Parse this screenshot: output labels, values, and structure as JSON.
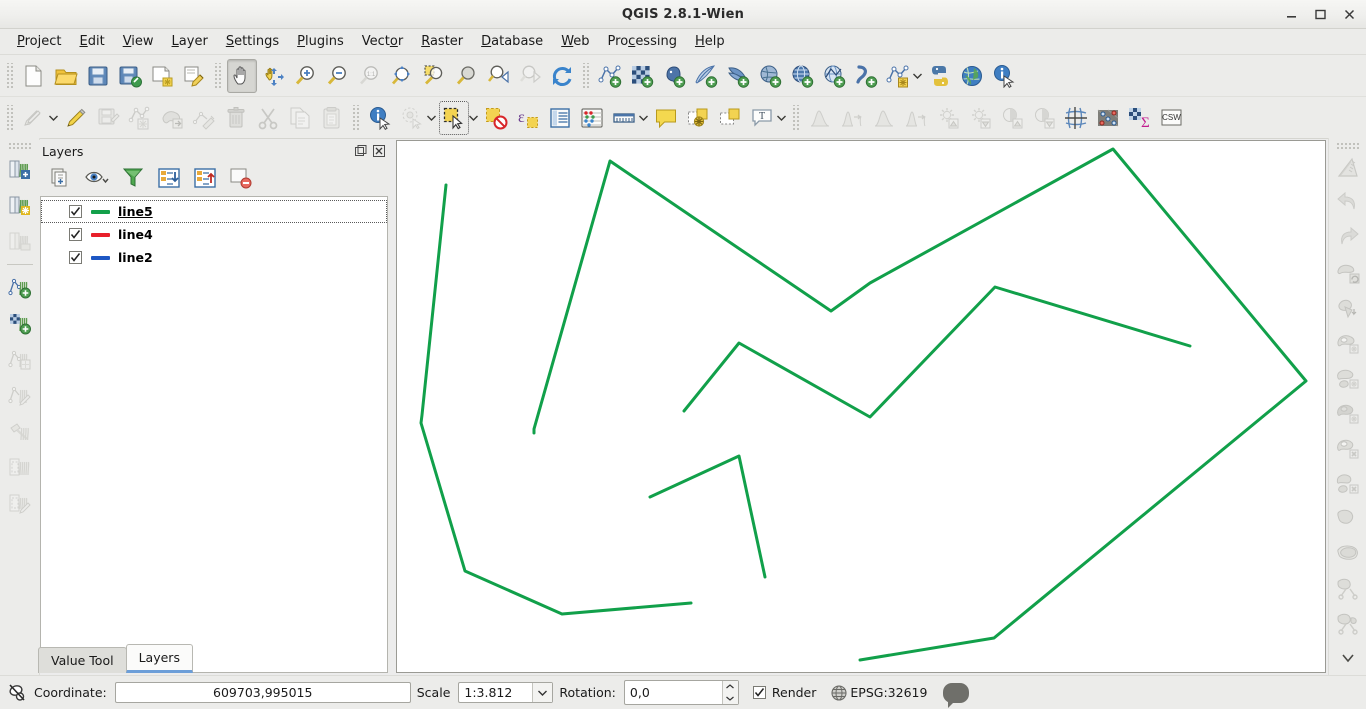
{
  "window": {
    "title": "QGIS 2.8.1-Wien",
    "minimize_label": "Minimize",
    "maximize_label": "Maximize",
    "close_label": "Close"
  },
  "menubar": {
    "items": [
      {
        "label": "Project",
        "mnemonic": "P"
      },
      {
        "label": "Edit",
        "mnemonic": "E"
      },
      {
        "label": "View",
        "mnemonic": "V"
      },
      {
        "label": "Layer",
        "mnemonic": "L"
      },
      {
        "label": "Settings",
        "mnemonic": "S"
      },
      {
        "label": "Plugins",
        "mnemonic": "P"
      },
      {
        "label": "Vector",
        "mnemonic": "o"
      },
      {
        "label": "Raster",
        "mnemonic": "R"
      },
      {
        "label": "Database",
        "mnemonic": "D"
      },
      {
        "label": "Web",
        "mnemonic": "W"
      },
      {
        "label": "Processing",
        "mnemonic": "c"
      },
      {
        "label": "Help",
        "mnemonic": "H"
      }
    ]
  },
  "toolbar_row1": {
    "buttons": [
      {
        "icon": "new-project-icon",
        "label": "New Project",
        "state": "enabled"
      },
      {
        "icon": "open-project-icon",
        "label": "Open Project",
        "state": "enabled"
      },
      {
        "icon": "save-project-icon",
        "label": "Save Project",
        "state": "enabled"
      },
      {
        "icon": "save-project-as-icon",
        "label": "Save Project As",
        "state": "enabled"
      },
      {
        "icon": "new-print-composer-icon",
        "label": "New Print Composer",
        "state": "enabled"
      },
      {
        "icon": "composer-manager-icon",
        "label": "Composer Manager",
        "state": "enabled"
      },
      {
        "icon": "pan-map-icon",
        "label": "Pan Map",
        "state": "active"
      },
      {
        "icon": "pan-to-selection-icon",
        "label": "Pan Map to Selection",
        "state": "enabled"
      },
      {
        "icon": "zoom-in-icon",
        "label": "Zoom In",
        "state": "enabled"
      },
      {
        "icon": "zoom-out-icon",
        "label": "Zoom Out",
        "state": "enabled"
      },
      {
        "icon": "zoom-native-icon",
        "label": "Zoom to Native Resolution",
        "state": "disabled"
      },
      {
        "icon": "zoom-full-icon",
        "label": "Zoom Full",
        "state": "enabled"
      },
      {
        "icon": "zoom-to-selection-icon",
        "label": "Zoom to Selection",
        "state": "enabled"
      },
      {
        "icon": "zoom-to-layer-icon",
        "label": "Zoom to Layer",
        "state": "enabled"
      },
      {
        "icon": "zoom-last-icon",
        "label": "Zoom Last",
        "state": "enabled"
      },
      {
        "icon": "zoom-next-icon",
        "label": "Zoom Next",
        "state": "disabled"
      },
      {
        "icon": "refresh-icon",
        "label": "Refresh",
        "state": "enabled"
      },
      {
        "icon": "add-vector-layer-icon",
        "label": "Add Vector Layer",
        "state": "enabled"
      },
      {
        "icon": "add-raster-layer-icon",
        "label": "Add Raster Layer",
        "state": "enabled"
      },
      {
        "icon": "add-postgis-layer-icon",
        "label": "Add PostGIS Layer",
        "state": "enabled"
      },
      {
        "icon": "add-spatialite-layer-icon",
        "label": "Add SpatiaLite Layer",
        "state": "enabled"
      },
      {
        "icon": "add-mssql-layer-icon",
        "label": "Add MSSQL Spatial Layer",
        "state": "enabled"
      },
      {
        "icon": "add-wcs-layer-icon",
        "label": "Add WCS Layer",
        "state": "enabled"
      },
      {
        "icon": "add-wfs-layer-icon",
        "label": "Add WFS Layer",
        "state": "enabled"
      },
      {
        "icon": "add-wms-layer-icon",
        "label": "Add WMS/WMTS Layer",
        "state": "enabled"
      },
      {
        "icon": "add-delimited-text-layer-icon",
        "label": "Add Delimited Text Layer",
        "state": "enabled"
      },
      {
        "icon": "new-shapefile-layer-icon",
        "label": "New Shapefile Layer",
        "state": "enabled"
      },
      {
        "icon": "python-console-icon",
        "label": "Python Console",
        "state": "enabled"
      },
      {
        "icon": "metasearch-icon",
        "label": "MetaSearch",
        "state": "enabled"
      },
      {
        "icon": "identify-features-icon",
        "label": "Identify Features",
        "state": "enabled"
      }
    ]
  },
  "toolbar_row2": {
    "buttons": [
      {
        "icon": "current-edits-icon",
        "label": "Current Edits",
        "state": "disabled"
      },
      {
        "icon": "toggle-editing-icon",
        "label": "Toggle Editing",
        "state": "enabled"
      },
      {
        "icon": "save-layer-edits-icon",
        "label": "Save Layer Edits",
        "state": "disabled"
      },
      {
        "icon": "add-feature-icon",
        "label": "Add Feature",
        "state": "disabled"
      },
      {
        "icon": "move-feature-icon",
        "label": "Move Feature",
        "state": "disabled"
      },
      {
        "icon": "node-tool-icon",
        "label": "Node Tool",
        "state": "disabled"
      },
      {
        "icon": "delete-selected-icon",
        "label": "Delete Selected",
        "state": "disabled"
      },
      {
        "icon": "cut-features-icon",
        "label": "Cut Features",
        "state": "disabled"
      },
      {
        "icon": "copy-features-icon",
        "label": "Copy Features",
        "state": "disabled"
      },
      {
        "icon": "paste-features-icon",
        "label": "Paste Features",
        "state": "disabled"
      },
      {
        "icon": "identify-icon",
        "label": "Identify Features",
        "state": "enabled"
      },
      {
        "icon": "select-by-radius-icon",
        "label": "Select Features by Radius",
        "state": "disabled"
      },
      {
        "icon": "select-features-icon",
        "label": "Select Features by Area or Single Click",
        "state": "selected"
      },
      {
        "icon": "deselect-all-icon",
        "label": "Deselect Features from All Layers",
        "state": "enabled"
      },
      {
        "icon": "select-by-expression-icon",
        "label": "Select Features using an Expression",
        "state": "enabled"
      },
      {
        "icon": "open-attribute-table-icon",
        "label": "Open Attribute Table",
        "state": "enabled"
      },
      {
        "icon": "field-calculator-icon",
        "label": "Open Field Calculator",
        "state": "enabled"
      },
      {
        "icon": "measure-line-icon",
        "label": "Measure Line",
        "state": "enabled"
      },
      {
        "icon": "map-tips-icon",
        "label": "Show Map Tips",
        "state": "enabled"
      },
      {
        "icon": "new-annotation-icon",
        "label": "New Annotation",
        "state": "enabled"
      },
      {
        "icon": "move-annotation-icon",
        "label": "Move Annotation",
        "state": "enabled"
      },
      {
        "icon": "text-annotation-icon",
        "label": "Text Annotation",
        "state": "enabled"
      },
      {
        "icon": "local-histogram-stretch-icon",
        "label": "Local Histogram Stretch",
        "state": "disabled"
      },
      {
        "icon": "full-histogram-stretch-icon",
        "label": "Stretch Histogram to Full Dataset",
        "state": "disabled"
      },
      {
        "icon": "local-cumulative-stretch-icon",
        "label": "Local Cumulative Cut Stretch",
        "state": "disabled"
      },
      {
        "icon": "full-cumulative-stretch-icon",
        "label": "Cumulative Cut Stretch to Full Dataset",
        "state": "disabled"
      },
      {
        "icon": "increase-brightness-icon",
        "label": "Increase Brightness",
        "state": "disabled"
      },
      {
        "icon": "decrease-brightness-icon",
        "label": "Decrease Brightness",
        "state": "disabled"
      },
      {
        "icon": "increase-contrast-icon",
        "label": "Increase Contrast",
        "state": "disabled"
      },
      {
        "icon": "decrease-contrast-icon",
        "label": "Decrease Contrast",
        "state": "disabled"
      },
      {
        "icon": "georeferencer-icon",
        "label": "Georeferencer",
        "state": "enabled"
      },
      {
        "icon": "raster-points-icon",
        "label": "Raster Sample Points",
        "state": "enabled"
      },
      {
        "icon": "zonal-statistics-icon",
        "label": "Zonal Statistics",
        "state": "enabled"
      },
      {
        "icon": "csw-icon",
        "label": "CSW",
        "state": "enabled"
      }
    ]
  },
  "left_toolbar": {
    "buttons": [
      {
        "icon": "grass-open-mapset-icon",
        "label": "Open Mapset",
        "state": "enabled"
      },
      {
        "icon": "grass-new-mapset-icon",
        "label": "New Mapset",
        "state": "enabled"
      },
      {
        "icon": "grass-close-mapset-icon",
        "label": "Close Mapset",
        "state": "disabled"
      },
      {
        "icon": "grass-add-vector-icon",
        "label": "Add GRASS Vector Layer",
        "state": "enabled"
      },
      {
        "icon": "grass-add-raster-icon",
        "label": "Add GRASS Raster Layer",
        "state": "enabled"
      },
      {
        "icon": "grass-new-vector-icon",
        "label": "Create New GRASS Vector",
        "state": "disabled"
      },
      {
        "icon": "grass-edit-vector-icon",
        "label": "Edit GRASS Vector Layer",
        "state": "disabled"
      },
      {
        "icon": "grass-tools-icon",
        "label": "Open GRASS Tools",
        "state": "disabled"
      },
      {
        "icon": "grass-region-icon",
        "label": "Display Current GRASS Region",
        "state": "disabled"
      },
      {
        "icon": "grass-edit-region-icon",
        "label": "Edit Current GRASS Region",
        "state": "disabled"
      }
    ]
  },
  "right_toolbar": {
    "buttons": [
      {
        "icon": "advanced-digitizing-icon",
        "label": "Enable Advanced Digitizing Tools",
        "state": "disabled"
      },
      {
        "icon": "undo-icon",
        "label": "Undo",
        "state": "disabled"
      },
      {
        "icon": "redo-icon",
        "label": "Redo",
        "state": "disabled"
      },
      {
        "icon": "rotate-feature-icon",
        "label": "Rotate Feature",
        "state": "disabled"
      },
      {
        "icon": "simplify-feature-icon",
        "label": "Simplify Feature",
        "state": "disabled"
      },
      {
        "icon": "add-ring-icon",
        "label": "Add Ring",
        "state": "disabled"
      },
      {
        "icon": "add-part-icon",
        "label": "Add Part",
        "state": "disabled"
      },
      {
        "icon": "fill-ring-icon",
        "label": "Fill Ring",
        "state": "disabled"
      },
      {
        "icon": "delete-ring-icon",
        "label": "Delete Ring",
        "state": "disabled"
      },
      {
        "icon": "delete-part-icon",
        "label": "Delete Part",
        "state": "disabled"
      },
      {
        "icon": "reshape-features-icon",
        "label": "Reshape Features",
        "state": "disabled"
      },
      {
        "icon": "offset-curve-icon",
        "label": "Offset Curve",
        "state": "disabled"
      },
      {
        "icon": "split-features-icon",
        "label": "Split Features",
        "state": "disabled"
      },
      {
        "icon": "split-parts-icon",
        "label": "Split Parts",
        "state": "disabled"
      },
      {
        "icon": "toolbar-overflow-icon",
        "label": "More tools",
        "state": "enabled"
      }
    ]
  },
  "layers_panel": {
    "title": "Layers",
    "float_label": "Float panel",
    "close_label": "Close panel",
    "toolbar": [
      {
        "icon": "add-group-icon",
        "label": "Add Group"
      },
      {
        "icon": "manage-visibility-icon",
        "label": "Manage Layer Visibility"
      },
      {
        "icon": "filter-legend-icon",
        "label": "Filter Legend by Map Content"
      },
      {
        "icon": "expand-all-icon",
        "label": "Expand All"
      },
      {
        "icon": "collapse-all-icon",
        "label": "Collapse All"
      },
      {
        "icon": "remove-layer-icon",
        "label": "Remove Layer/Group"
      }
    ],
    "layers": [
      {
        "name": "line5",
        "color": "#13a04a",
        "visible": true,
        "selected": true
      },
      {
        "name": "line4",
        "color": "#e8202a",
        "visible": true,
        "selected": false
      },
      {
        "name": "line2",
        "color": "#1d57c4",
        "visible": true,
        "selected": false
      }
    ]
  },
  "dock_tabs": [
    {
      "label": "Value Tool",
      "active": false
    },
    {
      "label": "Layers",
      "active": true
    }
  ],
  "map": {
    "background": "#ffffff",
    "line_color": "#11a04a",
    "line_width": 3
  },
  "statusbar": {
    "messages_icon": "messages-icon",
    "coordinate_label": "Coordinate:",
    "coordinate_value": "609703,995015",
    "scale_label": "Scale",
    "scale_value": "1:3.812",
    "rotation_label": "Rotation:",
    "rotation_value": "0,0",
    "render_label": "Render",
    "render_checked": true,
    "crs_label": "EPSG:32619",
    "crs_icon": "crs-globe-icon",
    "log_icon": "log-messages-icon"
  }
}
